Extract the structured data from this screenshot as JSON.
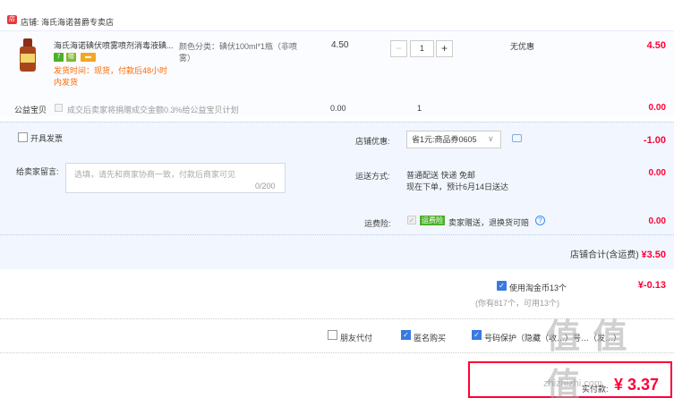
{
  "store": {
    "icon": "store-icon",
    "icon_glyph": "店",
    "name": "店铺: 海氏海诺普爵专卖店"
  },
  "item": {
    "title": "海氏海诺碘伏喷雾喷剂消毒液碘...",
    "badges": [
      "7",
      "赠",
      "▬"
    ],
    "ship_note": "发货时间：现货，付款后48小时内发货",
    "spec": "颜色分类：碘伏100ml*1瓶（非喷雾）",
    "price": "4.50",
    "qty_minus": "−",
    "qty": "1",
    "qty_plus": "+",
    "discount": "无优惠",
    "subtotal": "4.50"
  },
  "charity": {
    "label": "公益宝贝",
    "text": "成交后卖家将捐赠成交金额0.3%给公益宝贝计划",
    "price": "0.00",
    "qty": "1",
    "subtotal": "0.00"
  },
  "invoice": {
    "label": "开具发票"
  },
  "message": {
    "label": "给卖家留言:",
    "placeholder": "选填，请先和商家协商一致，付款后商家可见",
    "count": "0/200"
  },
  "coupon": {
    "label": "店铺优惠:",
    "value": "省1元:商品券0605",
    "chevron": "∨",
    "amount": "-1.00"
  },
  "delivery": {
    "label": "运送方式:",
    "line1": "普通配送 快递 免邮",
    "line2": "现在下单，预计6月14日送达",
    "amount": "0.00"
  },
  "insurance": {
    "label": "运费险:",
    "check": "✓",
    "badge": "运费险",
    "text": "卖家赠送，退换货可赔",
    "help": "?",
    "amount": "0.00"
  },
  "store_total": {
    "label": "店铺合计(含运费)",
    "amount": "¥3.50"
  },
  "coins": {
    "check": "✓",
    "label": "使用淘金币13个",
    "sub": "(你有817个，可用13个)",
    "amount": "¥-0.13"
  },
  "options": {
    "friend_pay": "朋友代付",
    "anon_buy": "匿名购买",
    "phone_protect": "号码保护（隐藏（收…）号…（发…）",
    "check": "✓"
  },
  "payment": {
    "label": "实付款:",
    "amount": "¥ 3.37"
  },
  "watermark": {
    "text": "值 值 值",
    "url": "zhizhizhi.com"
  },
  "colors": {
    "accent": "#ff0036",
    "blue": "#3a79e0",
    "options_bg": "#f2f7ff",
    "item_bg": "#fbfcff"
  }
}
